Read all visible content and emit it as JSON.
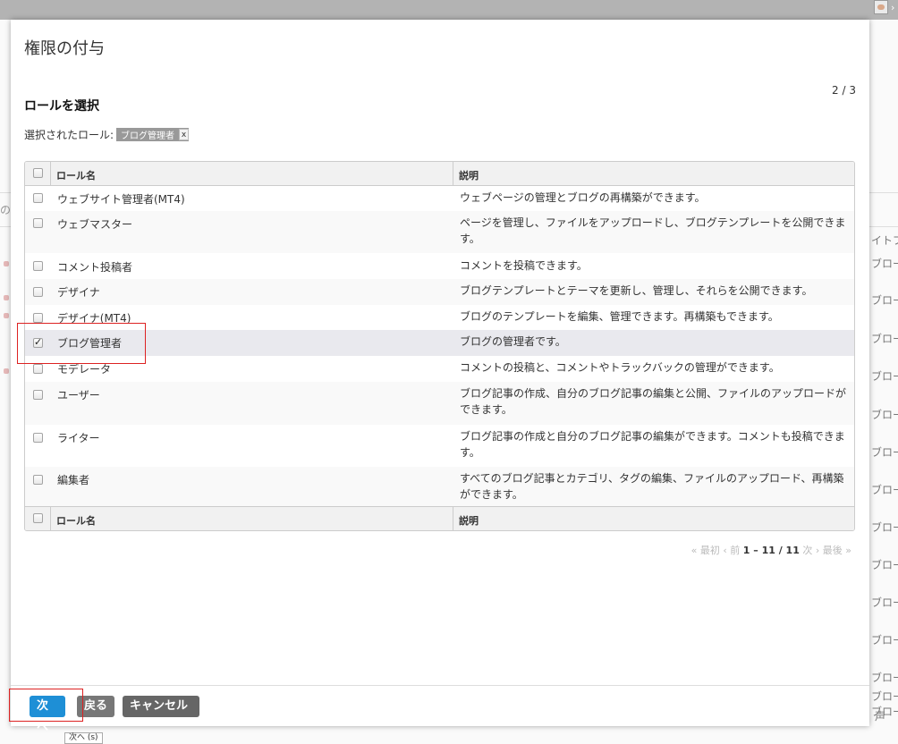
{
  "modal": {
    "title": "権限の付与",
    "step": "2 / 3",
    "section_title": "ロールを選択",
    "selected_label": "選択されたロール:",
    "selected_tag": "ブログ管理者",
    "tag_remove": "x"
  },
  "table": {
    "header_name": "ロール名",
    "header_desc": "説明",
    "footer_name": "ロール名",
    "footer_desc": "説明",
    "rows": [
      {
        "name": "ウェブサイト管理者(MT4)",
        "desc": "ウェブページの管理とブログの再構築ができます。",
        "checked": false
      },
      {
        "name": "ウェブマスター",
        "desc": "ページを管理し、ファイルをアップロードし、ブログテンプレートを公開できます。",
        "checked": false
      },
      {
        "name": "コメント投稿者",
        "desc": "コメントを投稿できます。",
        "checked": false
      },
      {
        "name": "デザイナ",
        "desc": "ブログテンプレートとテーマを更新し、管理し、それらを公開できます。",
        "checked": false
      },
      {
        "name": "デザイナ(MT4)",
        "desc": "ブログのテンプレートを編集、管理できます。再構築もできます。",
        "checked": false
      },
      {
        "name": "ブログ管理者",
        "desc": "ブログの管理者です。",
        "checked": true
      },
      {
        "name": "モデレータ",
        "desc": "コメントの投稿と、コメントやトラックバックの管理ができます。",
        "checked": false
      },
      {
        "name": "ユーザー",
        "desc": "ブログ記事の作成、自分のブログ記事の編集と公開、ファイルのアップロードができます。",
        "checked": false
      },
      {
        "name": "ライター",
        "desc": "ブログ記事の作成と自分のブログ記事の編集ができます。コメントも投稿できます。",
        "checked": false
      },
      {
        "name": "編集者",
        "desc": "すべてのブログ記事とカテゴリ、タグの編集、ファイルのアップロード、再構築ができます。",
        "checked": false
      }
    ]
  },
  "pager": {
    "first": "« 最初",
    "prev": "‹ 前",
    "range": "1 – 11 / 11",
    "next": "次 ›",
    "last": "最後 »"
  },
  "buttons": {
    "next": "次へ",
    "back": "戻る",
    "cancel": "キャンセル"
  },
  "tooltip": "次へ (s)",
  "background": {
    "left_fragment": "の",
    "right_texts": [
      "イトブ",
      "ブロー",
      "ブロー",
      "ブロー",
      "ブロー",
      "ブロー",
      "ブロー",
      "ブロー",
      "ブロー",
      "ブロー",
      "ブロー",
      "ブロー",
      "ブロー",
      "ブロー",
      "ブロー",
      "声"
    ]
  },
  "colors": {
    "primary_button": "#1e8fd6",
    "secondary_button": "#777777",
    "highlight": "#dd2222",
    "selected_row": "#e9e9ee"
  }
}
